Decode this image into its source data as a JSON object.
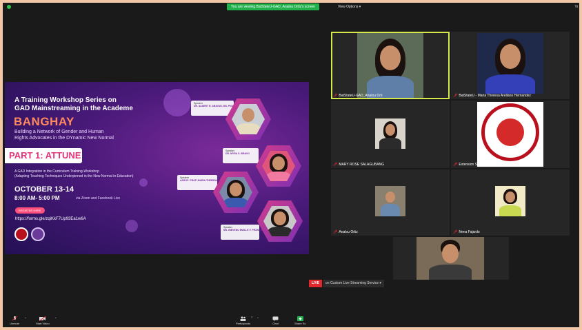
{
  "topbar": {
    "viewing_banner": "You are viewing BatStateU-GAD_Analou Ortiz's screen",
    "view_options": "View Options",
    "view_button": "Vi"
  },
  "slide": {
    "title_line1": "A Training Workshop Series on",
    "title_line2": "GAD Mainstreaming in the Academe",
    "banghay": "BANGHAY",
    "subtitle_line1": "Building a Network of Gender and Human",
    "subtitle_line2": "Rights Advocates in the DYnamic New Normal",
    "part": "PART 1: ATTUNE",
    "desc_line1": "A GAD Integration in the Curriculum Training-Workshop",
    "desc_line2": "(Adapting Teaching Techniques Underpinned in the New Normal in Education)",
    "date": "OCTOBER 13-14",
    "time": "8:00 AM- 5:00 PM",
    "via": "via Zoom and Facebook Live",
    "register": "REGISTER HERE",
    "url": "https://forms.gle/zqiKkF7Up93Ea1w6A",
    "speaker_tag": "Speaker",
    "speakers": [
      "DR. ALBERT R. ABAYAN, MS, PhD",
      "DR. MYRA S. BRAVO",
      "ASSOC. PROF. MARIA THERESA G. HERNANDEZ",
      "MS. BIEVENU EMILLE V. FRANCISCO"
    ]
  },
  "tiles": [
    {
      "name": "BatStateU-GAD_Analou Orti",
      "active": true
    },
    {
      "name": "BatStateU - Maria Theresa Arellano Hernandez",
      "active": false
    },
    {
      "name": "MARY ROSE SALAGUBANG",
      "active": false
    },
    {
      "name": "Extension Services Office-BatStateU",
      "active": false
    },
    {
      "name": "Analou Ortiz",
      "active": false
    },
    {
      "name": "Nena Fajardo",
      "active": false
    },
    {
      "name": "",
      "active": false
    }
  ],
  "live": {
    "badge": "LIVE",
    "text": "on Custom Live Streaming Service"
  },
  "toolbar": {
    "unmute": "Unmute",
    "start_video": "Start Video",
    "participants": "Participants",
    "participants_count": "7",
    "chat": "Chat",
    "share": "Share Sc"
  },
  "colors": {
    "accent_green": "#22b14c",
    "live_red": "#e0272e",
    "active_border": "#d6e94a"
  }
}
